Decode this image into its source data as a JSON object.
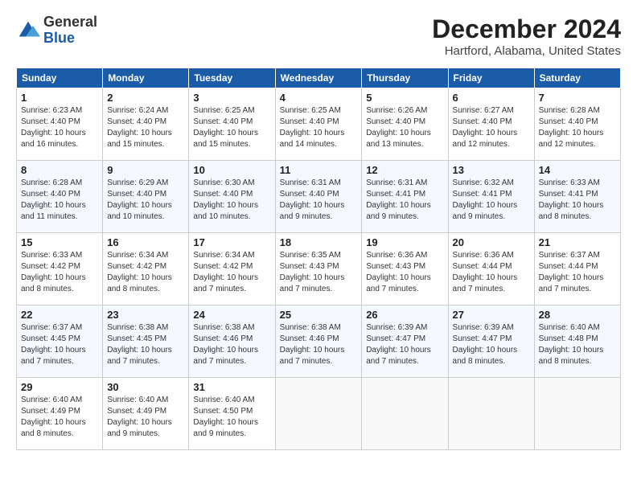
{
  "logo": {
    "general": "General",
    "blue": "Blue"
  },
  "title": "December 2024",
  "subtitle": "Hartford, Alabama, United States",
  "header_color": "#1a5ca8",
  "days_of_week": [
    "Sunday",
    "Monday",
    "Tuesday",
    "Wednesday",
    "Thursday",
    "Friday",
    "Saturday"
  ],
  "weeks": [
    [
      {
        "day": "1",
        "sunrise": "6:23 AM",
        "sunset": "4:40 PM",
        "daylight": "10 hours and 16 minutes."
      },
      {
        "day": "2",
        "sunrise": "6:24 AM",
        "sunset": "4:40 PM",
        "daylight": "10 hours and 15 minutes."
      },
      {
        "day": "3",
        "sunrise": "6:25 AM",
        "sunset": "4:40 PM",
        "daylight": "10 hours and 15 minutes."
      },
      {
        "day": "4",
        "sunrise": "6:25 AM",
        "sunset": "4:40 PM",
        "daylight": "10 hours and 14 minutes."
      },
      {
        "day": "5",
        "sunrise": "6:26 AM",
        "sunset": "4:40 PM",
        "daylight": "10 hours and 13 minutes."
      },
      {
        "day": "6",
        "sunrise": "6:27 AM",
        "sunset": "4:40 PM",
        "daylight": "10 hours and 12 minutes."
      },
      {
        "day": "7",
        "sunrise": "6:28 AM",
        "sunset": "4:40 PM",
        "daylight": "10 hours and 12 minutes."
      }
    ],
    [
      {
        "day": "8",
        "sunrise": "6:28 AM",
        "sunset": "4:40 PM",
        "daylight": "10 hours and 11 minutes."
      },
      {
        "day": "9",
        "sunrise": "6:29 AM",
        "sunset": "4:40 PM",
        "daylight": "10 hours and 10 minutes."
      },
      {
        "day": "10",
        "sunrise": "6:30 AM",
        "sunset": "4:40 PM",
        "daylight": "10 hours and 10 minutes."
      },
      {
        "day": "11",
        "sunrise": "6:31 AM",
        "sunset": "4:40 PM",
        "daylight": "10 hours and 9 minutes."
      },
      {
        "day": "12",
        "sunrise": "6:31 AM",
        "sunset": "4:41 PM",
        "daylight": "10 hours and 9 minutes."
      },
      {
        "day": "13",
        "sunrise": "6:32 AM",
        "sunset": "4:41 PM",
        "daylight": "10 hours and 9 minutes."
      },
      {
        "day": "14",
        "sunrise": "6:33 AM",
        "sunset": "4:41 PM",
        "daylight": "10 hours and 8 minutes."
      }
    ],
    [
      {
        "day": "15",
        "sunrise": "6:33 AM",
        "sunset": "4:42 PM",
        "daylight": "10 hours and 8 minutes."
      },
      {
        "day": "16",
        "sunrise": "6:34 AM",
        "sunset": "4:42 PM",
        "daylight": "10 hours and 8 minutes."
      },
      {
        "day": "17",
        "sunrise": "6:34 AM",
        "sunset": "4:42 PM",
        "daylight": "10 hours and 7 minutes."
      },
      {
        "day": "18",
        "sunrise": "6:35 AM",
        "sunset": "4:43 PM",
        "daylight": "10 hours and 7 minutes."
      },
      {
        "day": "19",
        "sunrise": "6:36 AM",
        "sunset": "4:43 PM",
        "daylight": "10 hours and 7 minutes."
      },
      {
        "day": "20",
        "sunrise": "6:36 AM",
        "sunset": "4:44 PM",
        "daylight": "10 hours and 7 minutes."
      },
      {
        "day": "21",
        "sunrise": "6:37 AM",
        "sunset": "4:44 PM",
        "daylight": "10 hours and 7 minutes."
      }
    ],
    [
      {
        "day": "22",
        "sunrise": "6:37 AM",
        "sunset": "4:45 PM",
        "daylight": "10 hours and 7 minutes."
      },
      {
        "day": "23",
        "sunrise": "6:38 AM",
        "sunset": "4:45 PM",
        "daylight": "10 hours and 7 minutes."
      },
      {
        "day": "24",
        "sunrise": "6:38 AM",
        "sunset": "4:46 PM",
        "daylight": "10 hours and 7 minutes."
      },
      {
        "day": "25",
        "sunrise": "6:38 AM",
        "sunset": "4:46 PM",
        "daylight": "10 hours and 7 minutes."
      },
      {
        "day": "26",
        "sunrise": "6:39 AM",
        "sunset": "4:47 PM",
        "daylight": "10 hours and 7 minutes."
      },
      {
        "day": "27",
        "sunrise": "6:39 AM",
        "sunset": "4:47 PM",
        "daylight": "10 hours and 8 minutes."
      },
      {
        "day": "28",
        "sunrise": "6:40 AM",
        "sunset": "4:48 PM",
        "daylight": "10 hours and 8 minutes."
      }
    ],
    [
      {
        "day": "29",
        "sunrise": "6:40 AM",
        "sunset": "4:49 PM",
        "daylight": "10 hours and 8 minutes."
      },
      {
        "day": "30",
        "sunrise": "6:40 AM",
        "sunset": "4:49 PM",
        "daylight": "10 hours and 9 minutes."
      },
      {
        "day": "31",
        "sunrise": "6:40 AM",
        "sunset": "4:50 PM",
        "daylight": "10 hours and 9 minutes."
      },
      null,
      null,
      null,
      null
    ]
  ]
}
